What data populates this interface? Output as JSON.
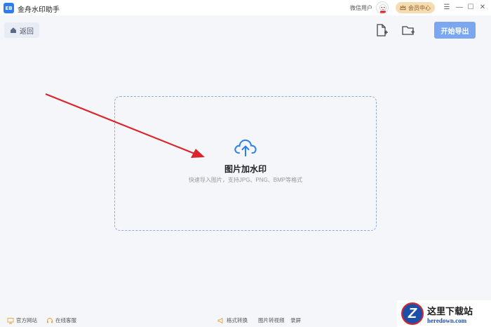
{
  "app": {
    "logo_text": "EB",
    "title": "金舟水印助手",
    "user_name": "微信用户",
    "vip_label": "会员中心",
    "window_controls": {
      "menu": "☰",
      "minimize": "—",
      "maximize": "☐",
      "close": "✕"
    }
  },
  "toolbar": {
    "back_label": "返回",
    "add_file_icon": "add-file-icon",
    "add_folder_icon": "add-folder-icon",
    "export_label": "开始导出"
  },
  "drop_zone": {
    "title": "图片加水印",
    "hint": "快速导入图片，支持JPG、PNG、BMP等格式"
  },
  "footer": {
    "left": [
      {
        "icon": "monitor-icon",
        "label": "官方网站"
      },
      {
        "icon": "headset-icon",
        "label": "在线客服"
      }
    ],
    "center": [
      {
        "icon": "megaphone-icon",
        "label": "格式转换"
      },
      {
        "icon": "",
        "label": "图片转视频"
      },
      {
        "icon": "",
        "label": "录屏"
      }
    ]
  },
  "watermark": {
    "logo_letter": "Z",
    "cn": "这里下载站",
    "en": "heredown.com"
  },
  "colors": {
    "accent": "#2a7ef0",
    "export_button": "#7aa7ef",
    "vip": "#f6dcb3",
    "arrow": "#d9262c",
    "dashed_border": "#8fa9d6"
  }
}
